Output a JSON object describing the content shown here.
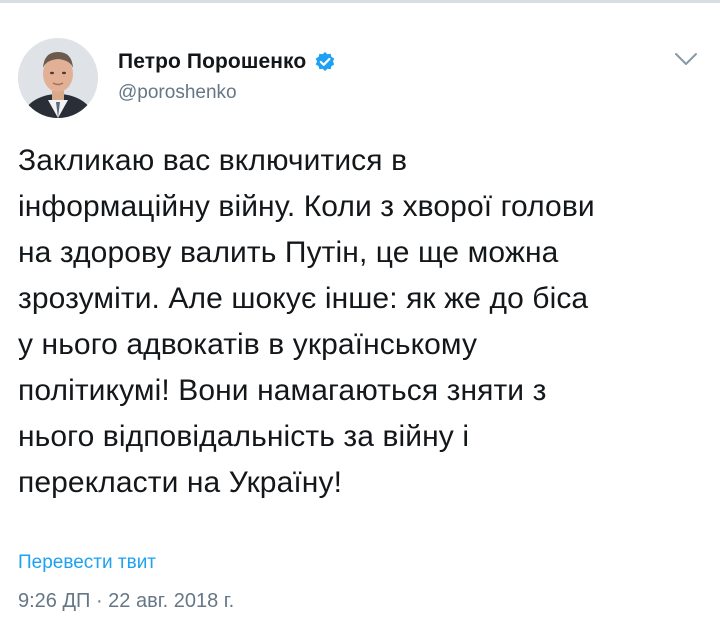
{
  "tweet": {
    "author": {
      "name": "Петро Порошенко",
      "handle": "@poroshenko",
      "verified": true
    },
    "text_lines": [
      "Закликаю вас включитися в",
      "інформаційну війну. Коли з хворої голови",
      "на здорову валить Путін, це ще можна",
      "зрозуміти. Але шокує інше: як же до біса",
      "у нього адвокатів в українському",
      "політикумі! Вони намагаються зняти з",
      "нього відповідальність за війну і",
      "перекласти на Україну!"
    ],
    "translate_label": "Перевести твит",
    "timestamp": "9:26 ДП · 22 авг. 2018 г."
  },
  "icons": {
    "verified": "verified-badge-icon",
    "menu": "chevron-down-icon"
  },
  "colors": {
    "link_blue": "#1da1f2",
    "secondary_text": "#657786",
    "primary_text": "#14171a"
  }
}
